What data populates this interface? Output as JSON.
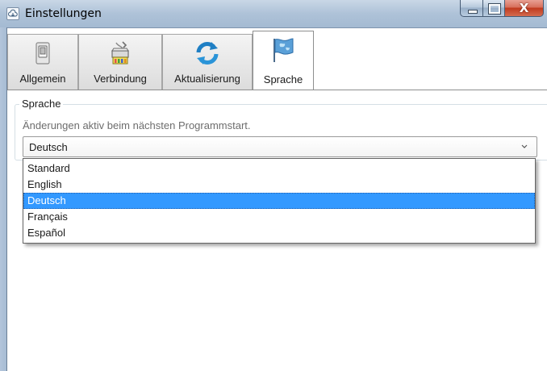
{
  "window": {
    "title": "Einstellungen",
    "close_glyph": "X"
  },
  "tabs": [
    {
      "label": "Allgemein",
      "icon": "switch-icon",
      "active": false
    },
    {
      "label": "Verbindung",
      "icon": "network-connector-icon",
      "active": false
    },
    {
      "label": "Aktualisierung",
      "icon": "refresh-icon",
      "active": false
    },
    {
      "label": "Sprache",
      "icon": "flag-icon",
      "active": true
    }
  ],
  "language_group": {
    "title": "Sprache",
    "hint": "Änderungen aktiv beim nächsten Programmstart.",
    "selected": "Deutsch",
    "options": [
      "Standard",
      "English",
      "Deutsch",
      "Français",
      "Español"
    ]
  },
  "colors": {
    "selection": "#3399ff",
    "close_button": "#c0391e"
  }
}
